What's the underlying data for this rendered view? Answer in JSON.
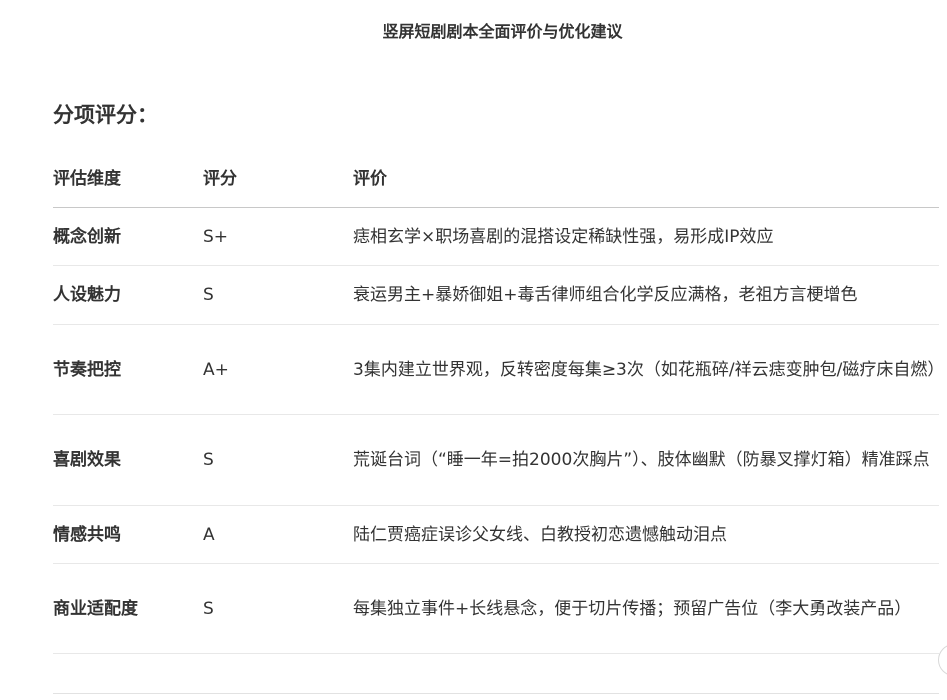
{
  "document": {
    "title": "竖屏短剧剧本全面评价与优化建议",
    "section_heading": "分项评分："
  },
  "table": {
    "headers": [
      "评估维度",
      "评分",
      "评价"
    ],
    "rows": [
      {
        "dimension": "概念创新",
        "score": "S+",
        "comment": "痣相玄学×职场喜剧的混搭设定稀缺性强，易形成IP效应"
      },
      {
        "dimension": "人设魅力",
        "score": "S",
        "comment": "衰运男主+暴娇御姐+毒舌律师组合化学反应满格，老祖方言梗增色"
      },
      {
        "dimension": "节奏把控",
        "score": "A+",
        "comment": "3集内建立世界观，反转密度每集≥3次（如花瓶碎/祥云痣变肿包/磁疗床自燃）"
      },
      {
        "dimension": "喜剧效果",
        "score": "S",
        "comment": "荒诞台词（“睡一年=拍2000次胸片”）、肢体幽默（防暴叉撑灯箱）精准踩点"
      },
      {
        "dimension": "情感共鸣",
        "score": "A",
        "comment": "陆仁贾癌症误诊父女线、白教授初恋遗憾触动泪点"
      },
      {
        "dimension": "商业适配度",
        "score": "S",
        "comment": "每集独立事件+长线悬念，便于切片传播；预留广告位（李大勇改装产品）"
      }
    ]
  }
}
